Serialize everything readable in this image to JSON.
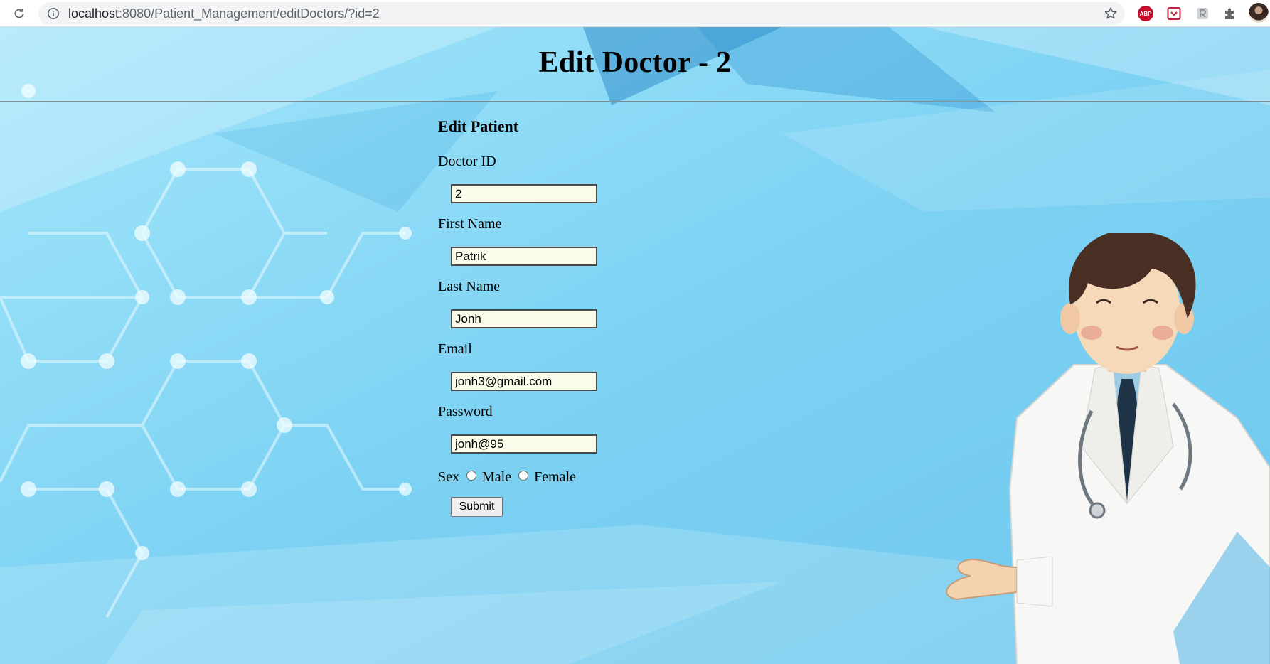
{
  "browser": {
    "url_host": "localhost",
    "url_path": ":8080/Patient_Management/editDoctors/?id=2",
    "extensions": [
      "adblock-plus-icon",
      "pocket-icon",
      "reader-icon",
      "puzzle-icon"
    ],
    "abp_text": "ABP"
  },
  "page": {
    "title": "Edit Doctor - 2",
    "form_title": "Edit Patient",
    "fields": {
      "doctor_id": {
        "label": "Doctor ID",
        "value": "2"
      },
      "first_name": {
        "label": "First Name",
        "value": "Patrik"
      },
      "last_name": {
        "label": "Last Name",
        "value": "Jonh"
      },
      "email": {
        "label": "Email",
        "value": "jonh3@gmail.com"
      },
      "password": {
        "label": "Password",
        "value": "jonh@95"
      }
    },
    "sex": {
      "label": "Sex",
      "options": [
        "Male",
        "Female"
      ],
      "selected": null
    },
    "submit_label": "Submit"
  },
  "colors": {
    "background_light": "#8ad8f4",
    "background_dark": "#4fb3e0",
    "field_background": "#fbfbe9"
  }
}
